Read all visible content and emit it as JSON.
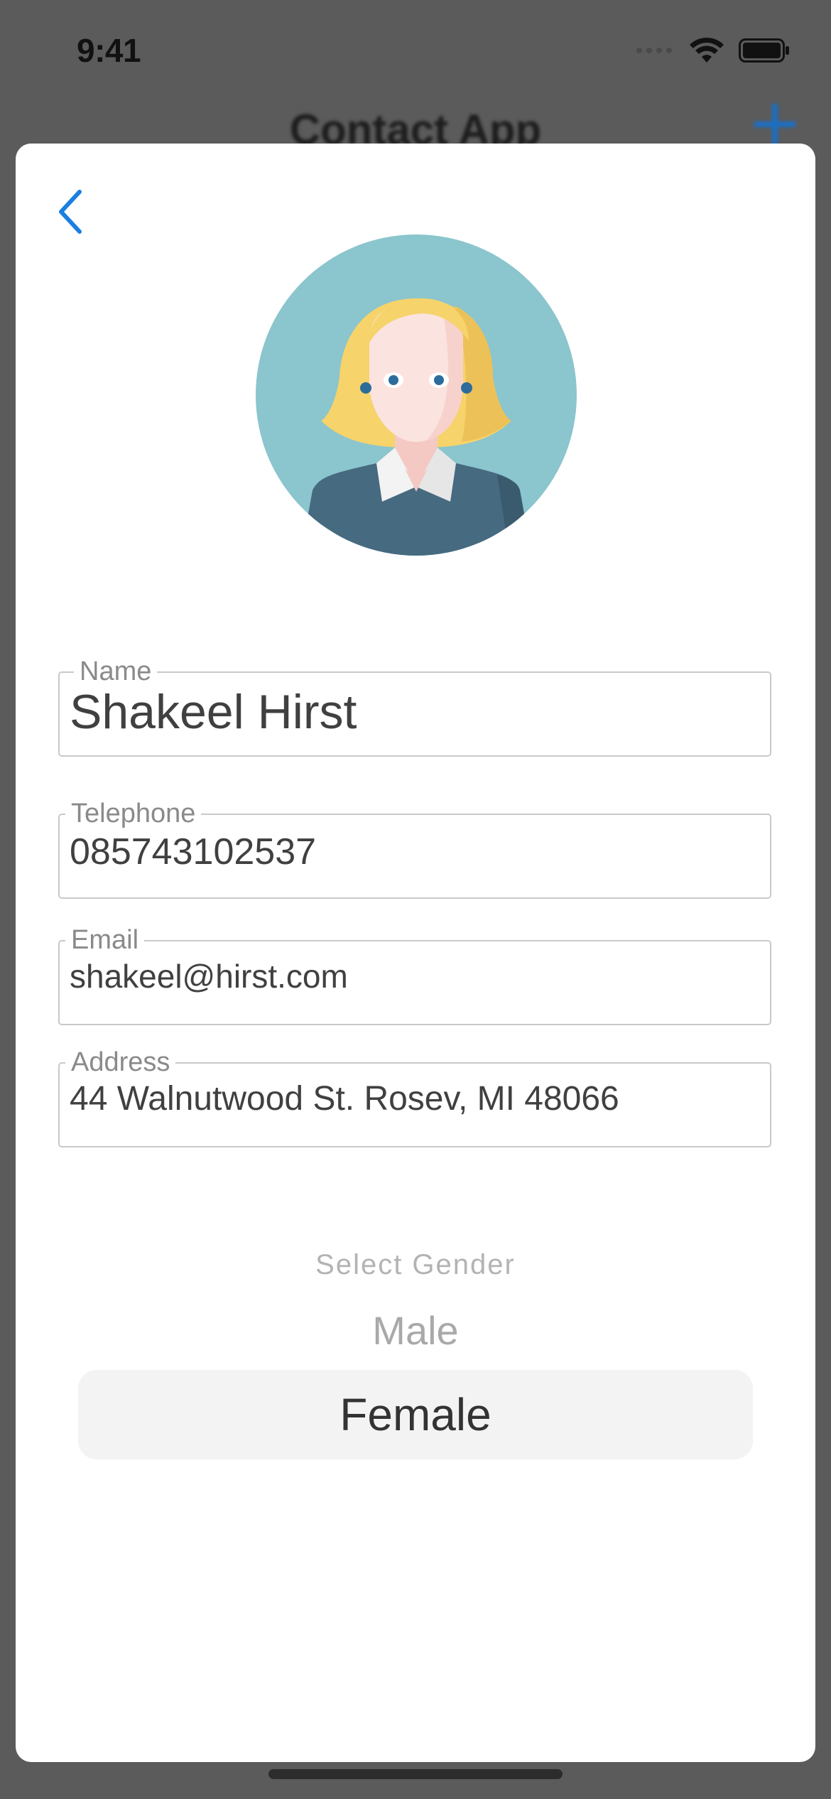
{
  "status_bar": {
    "time": "9:41",
    "icons": [
      "cellular-signal-icon",
      "wifi-icon",
      "battery-icon"
    ]
  },
  "background_nav": {
    "title": "Contact App",
    "add_icon": "plus-icon"
  },
  "sheet": {
    "back_icon": "chevron-left-icon",
    "avatar_icon": "female-avatar-icon",
    "fields": {
      "name": {
        "label": "Name",
        "value": "Shakeel Hirst"
      },
      "telephone": {
        "label": "Telephone",
        "value": "085743102537"
      },
      "email": {
        "label": "Email",
        "value": "shakeel@hirst.com"
      },
      "address": {
        "label": "Address",
        "value": "44 Walnutwood St. Rosev, MI 48066"
      }
    },
    "gender_picker": {
      "title": "Select Gender",
      "options": [
        "Male",
        "Female"
      ],
      "selected": "Female"
    }
  },
  "colors": {
    "accent": "#1a7fe0",
    "overlay": "#5b5b5b",
    "avatar_background": "#8bc5cd",
    "field_border": "#c9c9c9",
    "selected_row": "#f3f3f3"
  }
}
